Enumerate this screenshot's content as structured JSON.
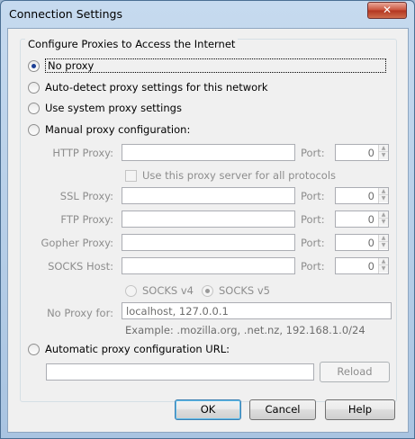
{
  "window": {
    "title": "Connection Settings",
    "close_symbol": "✕"
  },
  "group": {
    "legend": "Configure Proxies to Access the Internet"
  },
  "options": {
    "no_proxy": "No proxy",
    "auto_detect": "Auto-detect proxy settings for this network",
    "system": "Use system proxy settings",
    "manual": "Manual proxy configuration:",
    "auto_url": "Automatic proxy configuration URL:"
  },
  "manual": {
    "http_label": "HTTP Proxy:",
    "ssl_label": "SSL Proxy:",
    "ftp_label": "FTP Proxy:",
    "gopher_label": "Gopher Proxy:",
    "socks_label": "SOCKS Host:",
    "port_label": "Port:",
    "http_port": "0",
    "ssl_port": "0",
    "ftp_port": "0",
    "gopher_port": "0",
    "socks_port": "0",
    "same_proxy": "Use this proxy server for all protocols",
    "socks_v4": "SOCKS v4",
    "socks_v5": "SOCKS v5",
    "no_proxy_for_label": "No Proxy for:",
    "no_proxy_for_value": "localhost, 127.0.0.1",
    "example": "Example: .mozilla.org, .net.nz, 192.168.1.0/24"
  },
  "buttons": {
    "reload": "Reload",
    "ok": "OK",
    "cancel": "Cancel",
    "help": "Help"
  },
  "state": {
    "selected": "no_proxy",
    "socks_version": "v5"
  }
}
